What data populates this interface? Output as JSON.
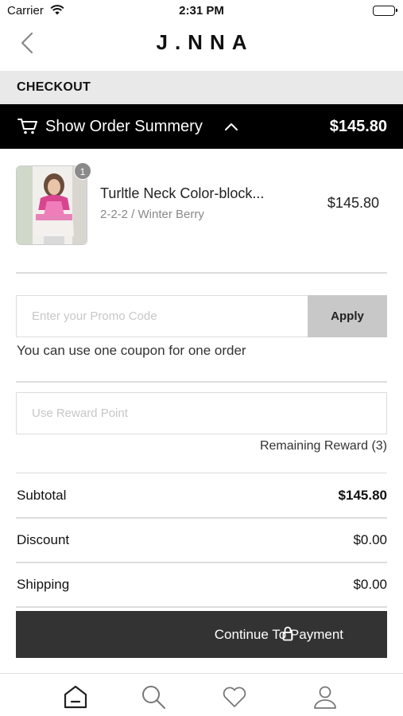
{
  "status_bar": {
    "carrier": "Carrier",
    "time": "2:31 PM"
  },
  "nav": {
    "back_icon": "chevron-left-icon",
    "logo": "J.NNA"
  },
  "checkout": {
    "title": "CHECKOUT"
  },
  "order_summary": {
    "label": "Show Order Summery",
    "total": "$145.80",
    "cart_icon": "cart-icon",
    "toggle_icon": "chevron-up-icon"
  },
  "product": {
    "name": "Turltle Neck Color-block...",
    "variant": "2-2-2 / Winter Berry",
    "price": "$145.80",
    "quantity": "1"
  },
  "promo": {
    "placeholder": "Enter your Promo Code",
    "apply_label": "Apply",
    "note": "You can use one coupon for one order"
  },
  "reward": {
    "placeholder": "Use Reward Point",
    "remaining": "Remaining Reward (3)"
  },
  "totals": {
    "subtotal_label": "Subtotal",
    "subtotal_value": "$145.80",
    "discount_label": "Discount",
    "discount_value": "$0.00",
    "shipping_label": "Shipping",
    "shipping_value": "$0.00"
  },
  "continue": {
    "label": "Continue To Payment",
    "icon": "lock-icon"
  },
  "tabs": [
    {
      "icon": "home-icon"
    },
    {
      "icon": "search-icon"
    },
    {
      "icon": "heart-icon"
    },
    {
      "icon": "profile-icon"
    }
  ]
}
